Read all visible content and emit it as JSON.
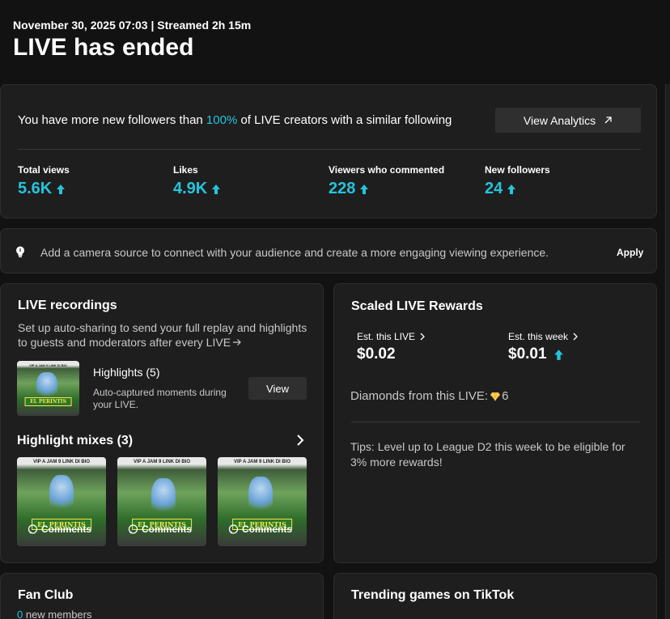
{
  "header": {
    "meta": "November 30, 2025 07:03 | Streamed 2h 15m",
    "title": "LIVE has ended"
  },
  "summary": {
    "message_before": "You have more new followers than ",
    "message_highlight": "100%",
    "message_after": " of LIVE creators with a similar following",
    "analytics_label": "View Analytics",
    "stats": [
      {
        "label": "Total views",
        "value": "5.6K"
      },
      {
        "label": "Likes",
        "value": "4.9K"
      },
      {
        "label": "Viewers who commented",
        "value": "228"
      },
      {
        "label": "New followers",
        "value": "24"
      }
    ]
  },
  "tip": {
    "text": "Add a camera source to connect with your audience and create a more engaging viewing experience.",
    "apply_label": "Apply"
  },
  "recordings": {
    "title": "LIVE recordings",
    "description": "Set up auto-sharing to send your full replay and highlights to guests and moderators after every LIVE",
    "highlights_title": "Highlights (5)",
    "highlights_sub": "Auto-captured moments during your LIVE.",
    "view_label": "View",
    "mixes_title": "Highlight mixes (3)",
    "thumb_caption": "VIP A JAM 9 LINK DI BIO",
    "thumb_banner": "EL PERINTIS",
    "mixes": [
      {
        "label": "Comments"
      },
      {
        "label": "Comments"
      },
      {
        "label": "Comments"
      }
    ]
  },
  "rewards": {
    "title": "Scaled LIVE Rewards",
    "est_live_label": "Est. this LIVE",
    "est_live_value": "$0.02",
    "est_week_label": "Est. this week",
    "est_week_value": "$0.01",
    "diamonds_label": "Diamonds from this LIVE:",
    "diamonds_value": "6",
    "tip_text": "Tips: Level up to League D2 this week to be eligible for 3% more rewards!"
  },
  "fanclub": {
    "title": "Fan Club",
    "count": "0",
    "sub": " new members"
  },
  "trending": {
    "title": "Trending games on TikTok"
  },
  "colors": {
    "accent": "#25c4dc",
    "background": "#121212",
    "card": "#1e1e1e"
  }
}
